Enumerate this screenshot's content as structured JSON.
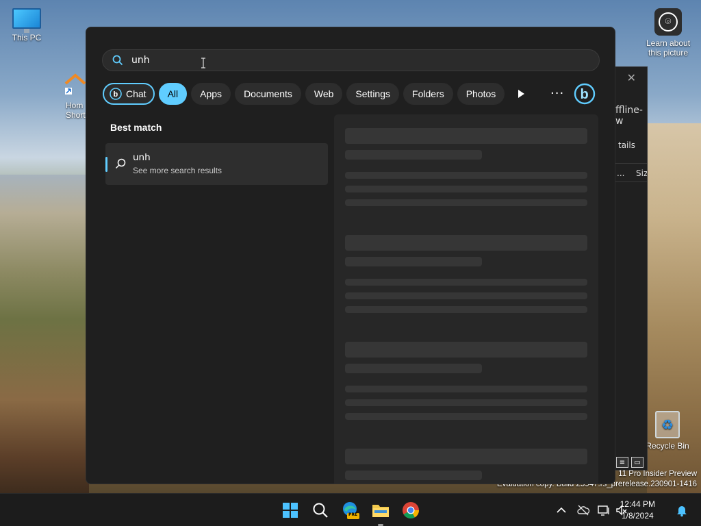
{
  "desktop": {
    "this_pc_label": "This PC",
    "home_label_1": "Hom",
    "home_label_2": "Short",
    "learn_label_1": "Learn about",
    "learn_label_2": "this picture",
    "recycle_label": "Recycle Bin",
    "watermark_1": "11 Pro Insider Preview",
    "watermark_2": "Evaluation copy. Build 25947.rs_prerelease.230901-1416"
  },
  "background_window": {
    "close_glyph": "✕",
    "title_fragment": "ffline-w",
    "details_fragment": "tails",
    "col_more": "...",
    "col_size": "Size"
  },
  "search": {
    "query": "unh",
    "filters": [
      {
        "label": "Chat",
        "active": false
      },
      {
        "label": "All",
        "active": true
      },
      {
        "label": "Apps",
        "active": false
      },
      {
        "label": "Documents",
        "active": false
      },
      {
        "label": "Web",
        "active": false
      },
      {
        "label": "Settings",
        "active": false
      },
      {
        "label": "Folders",
        "active": false
      },
      {
        "label": "Photos",
        "active": false
      }
    ],
    "more_glyph": "···",
    "best_match_label": "Best match",
    "result_title": "unh",
    "result_subtitle": "See more search results"
  },
  "taskbar": {
    "time": "12:44 PM",
    "date": "1/8/2024",
    "edge_badge": "PRE"
  },
  "colors": {
    "accent": "#60cdff",
    "panel": "#1f1f1f",
    "taskbar": "#1c1c1c"
  }
}
